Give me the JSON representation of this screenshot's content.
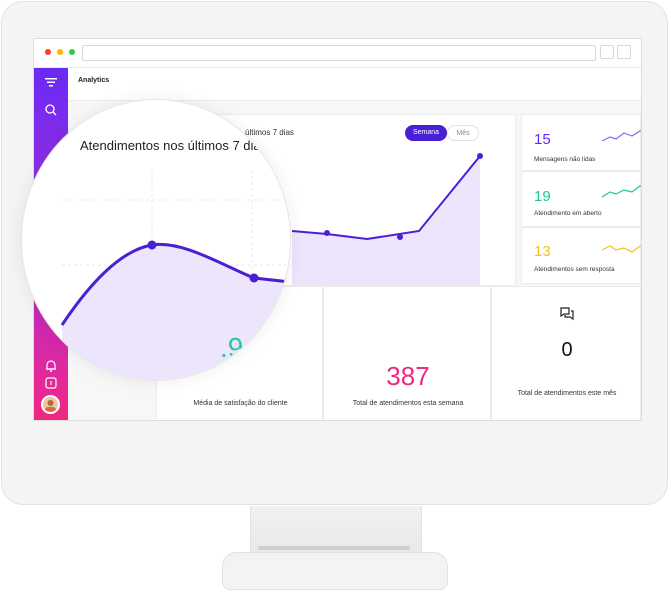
{
  "browser": {
    "dots": [
      "#ff3b30",
      "#ffb400",
      "#2ecc40"
    ]
  },
  "app": {
    "title": "Analytics"
  },
  "chart": {
    "title": "Atendimentos nos últimos 7 dias",
    "title_cropped": "últimos 7 dias",
    "toggle_week": "Semana",
    "toggle_month": "Mês",
    "accent": "#4a1fd6",
    "fill": "#ece5fb"
  },
  "stats": [
    {
      "value": "15",
      "label": "Mensagens não lidas",
      "color": "#6a2af5"
    },
    {
      "value": "19",
      "label": "Atendimento em aberto",
      "color": "#1fc98f"
    },
    {
      "value": "13",
      "label": "Atendimentos sem resposta",
      "color": "#f2c21b"
    }
  ],
  "bottom": {
    "satisfaction": {
      "value_partial": ".9",
      "label": "Média de satisfação do cliente",
      "color": "#29c89a"
    },
    "total_week": {
      "value": "387",
      "label": "Total de atendimentos esta semana",
      "color": "#f0297e"
    },
    "total_month": {
      "value": "0",
      "label": "Total de atendimentos este mês"
    }
  },
  "icons": [
    "logo-icon",
    "search-icon",
    "bell-icon",
    "info-icon",
    "chat-icon"
  ],
  "magnifier": {
    "title": "Atendimentos nos últimos 7 dia",
    "value_partial": ".9"
  }
}
